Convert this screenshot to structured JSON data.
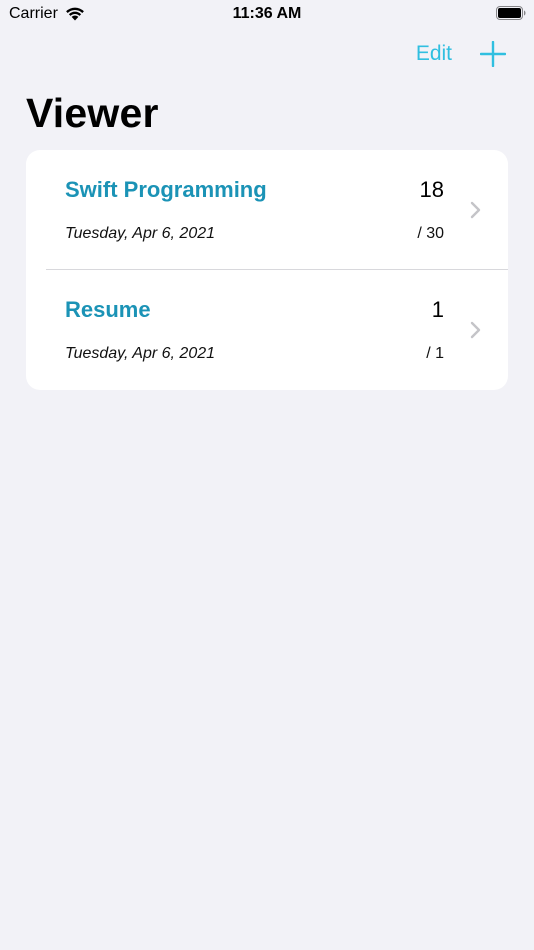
{
  "status_bar": {
    "carrier": "Carrier",
    "time": "11:36 AM"
  },
  "nav": {
    "edit_label": "Edit",
    "add_icon": "plus-icon"
  },
  "page_title": "Viewer",
  "documents": [
    {
      "title": "Swift Programming",
      "date": "Tuesday, Apr 6, 2021",
      "current_page": "18",
      "total_pages": "/ 30"
    },
    {
      "title": "Resume",
      "date": "Tuesday, Apr 6, 2021",
      "current_page": "1",
      "total_pages": "/ 1"
    }
  ],
  "colors": {
    "accent": "#30bfe0",
    "title_accent": "#1b93b6",
    "background": "#f2f2f7",
    "card": "#ffffff",
    "chevron": "#c4c4c8"
  }
}
